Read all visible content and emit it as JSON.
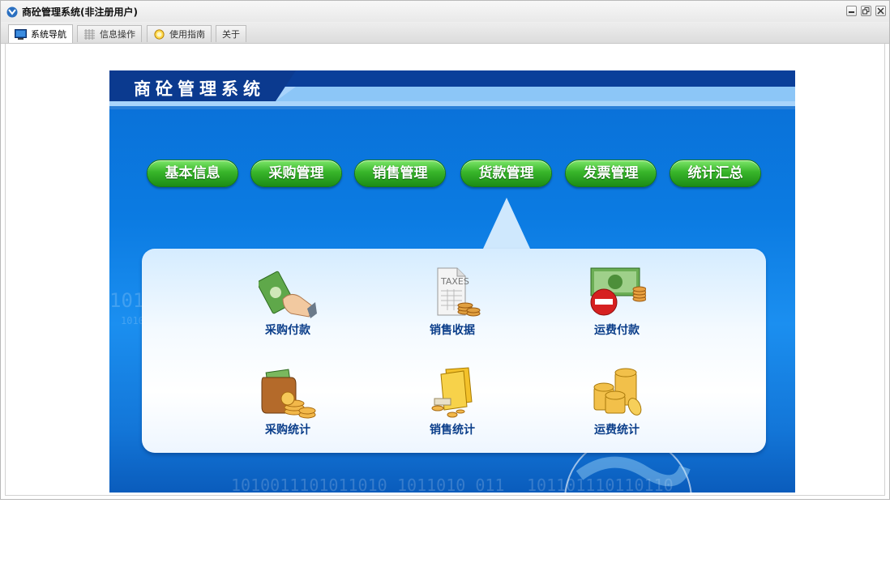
{
  "window": {
    "title": "商砼管理系统(非注册用户)"
  },
  "tabs": [
    {
      "label": "系统导航",
      "icon": "monitor-icon",
      "active": true
    },
    {
      "label": "信息操作",
      "icon": "grid-icon",
      "active": false
    },
    {
      "label": "使用指南",
      "icon": "lightbulb-icon",
      "active": false
    },
    {
      "label": "关于",
      "icon": "",
      "active": false
    }
  ],
  "app": {
    "title": "商砼管理系统",
    "modules": [
      "基本信息",
      "采购管理",
      "销售管理",
      "货款管理",
      "发票管理",
      "统计汇总"
    ],
    "items": [
      {
        "label": "采购付款",
        "icon": "money-hand-icon"
      },
      {
        "label": "销售收据",
        "icon": "taxes-document-icon"
      },
      {
        "label": "运费付款",
        "icon": "money-stop-icon"
      },
      {
        "label": "采购统计",
        "icon": "wallet-coins-icon"
      },
      {
        "label": "销售统计",
        "icon": "folder-coins-icon"
      },
      {
        "label": "运费统计",
        "icon": "coin-stack-icon"
      }
    ],
    "taxes_text": "TAXES",
    "decor_binary": [
      "1010011101011010",
      "1011010_011",
      "101101110110110",
      "1010",
      "1010"
    ]
  },
  "colors": {
    "accent": "#0b7be2",
    "button_green": "#2aa321",
    "label_blue": "#0b3e8a"
  }
}
